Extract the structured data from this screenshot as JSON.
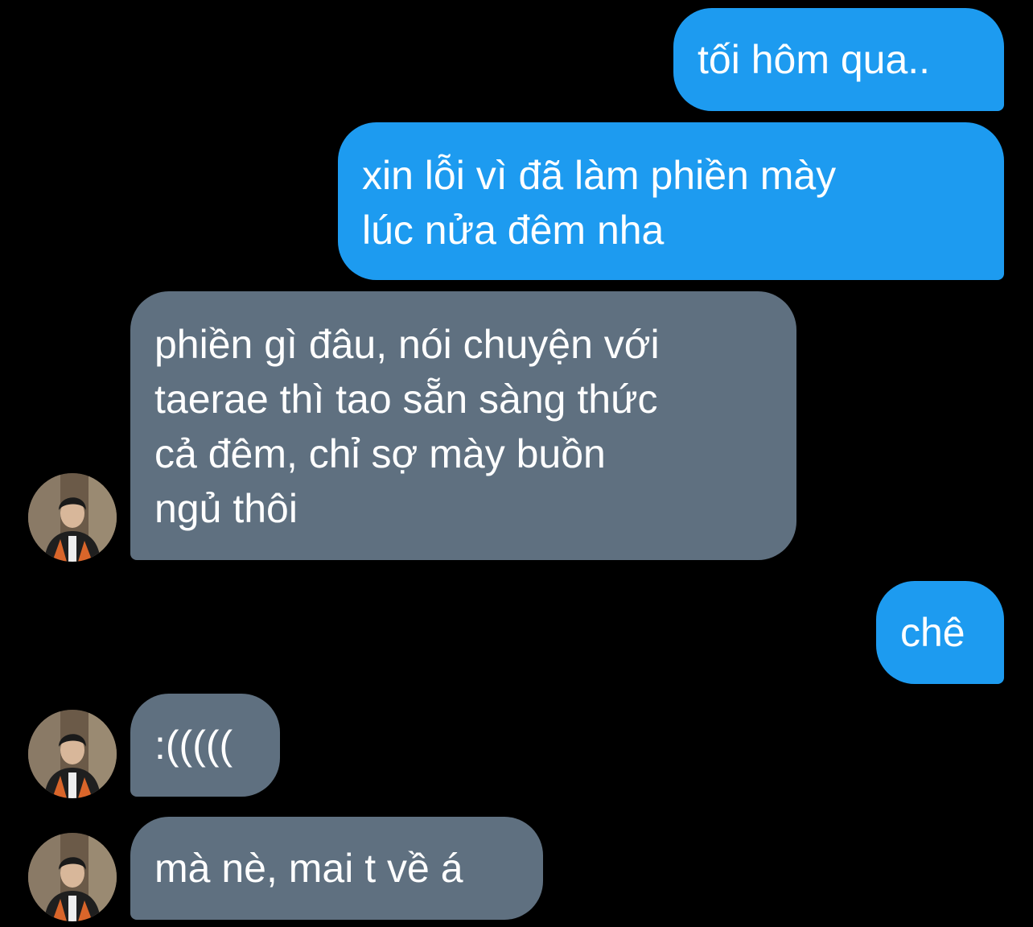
{
  "conversation": {
    "messages": [
      {
        "sender": "me",
        "text": "tối hôm qua.."
      },
      {
        "sender": "me",
        "text": "xin lỗi vì đã làm phiền mày\nlúc nửa đêm nha"
      },
      {
        "sender": "them",
        "text": "phiền gì đâu, nói chuyện với\ntaerae thì tao sẵn sàng thức\ncả đêm, chỉ sợ mày buồn\nngủ thôi"
      },
      {
        "sender": "me",
        "text": "chê"
      },
      {
        "sender": "them",
        "text": ":((((("
      },
      {
        "sender": "them",
        "text": "mà nè, mai t về á"
      }
    ]
  },
  "colors": {
    "background": "#000000",
    "outgoing_bubble": "#1d9bf0",
    "incoming_bubble": "#5f7080",
    "text": "#ffffff"
  },
  "icons": {
    "avatar": "contact-avatar-photo"
  }
}
